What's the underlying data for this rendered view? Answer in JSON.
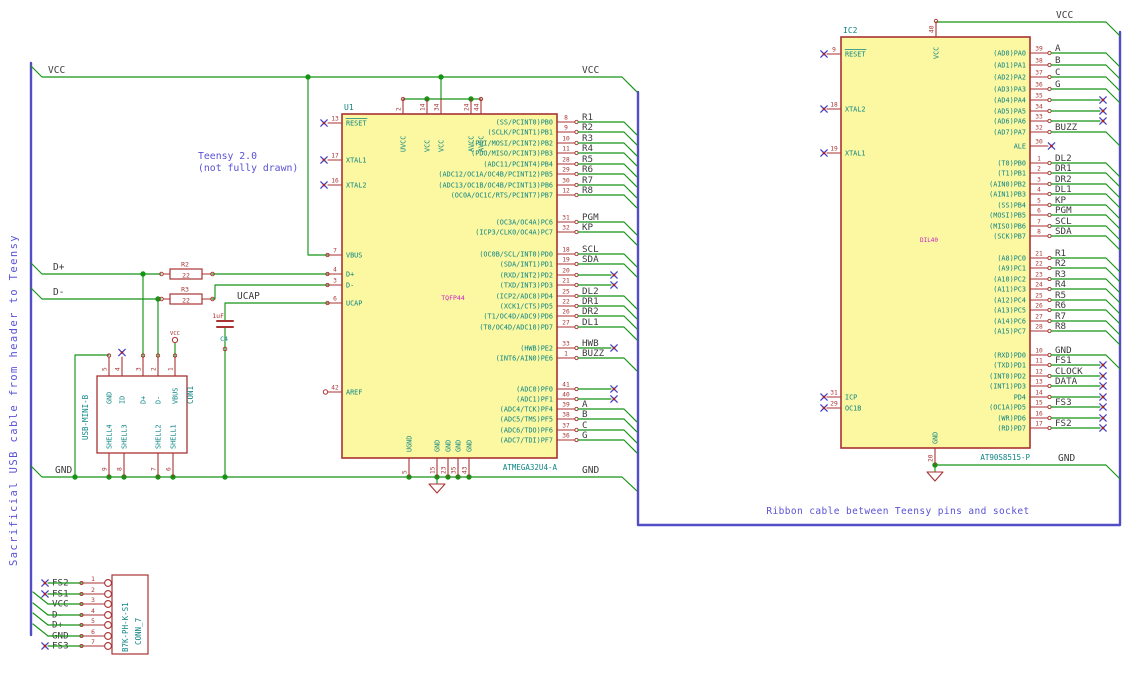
{
  "colors": {
    "wire": "#169416",
    "bus": "#544dc8",
    "outline": "#a93232",
    "fill": "#fbf8a1",
    "pin_name": "#0d8484",
    "pin_num": "#a93232",
    "label": "#3a3a3a",
    "note": "#5a52d5",
    "footprint": "#c820c8",
    "nc": "#4840c0"
  },
  "notes": {
    "cable": "Sacrificial USB cable from header to Teensy",
    "teensy1": "Teensy 2.0",
    "teensy2": "(not fully drawn)",
    "ribbon": "Ribbon cable between Teensy pins and socket"
  },
  "net_labels": {
    "vcc": "VCC",
    "gnd": "GND",
    "dplus": "D+",
    "dminus": "D-",
    "ucap": "UCAP"
  },
  "u1": {
    "ref": "U1",
    "value": "ATMEGA32U4-A",
    "footprint": "TQFP44",
    "top_pins": [
      {
        "num": "2",
        "name": "UVCC"
      },
      {
        "num": "14",
        "name": "VCC"
      },
      {
        "num": "34",
        "name": "VCC"
      },
      {
        "num": "24",
        "name": "AVCC"
      },
      {
        "num": "44",
        "name": "AVCC"
      }
    ],
    "bottom_pins": [
      {
        "num": "5",
        "name": "UGND"
      },
      {
        "num": "15",
        "name": "GND"
      },
      {
        "num": "23",
        "name": "GND"
      },
      {
        "num": "35",
        "name": "GND"
      },
      {
        "num": "43",
        "name": "GND"
      }
    ],
    "left_pins": [
      {
        "num": "13",
        "name": "RESET",
        "overline": true,
        "term": "nc"
      },
      {
        "num": "17",
        "name": "XTAL1",
        "term": "nc"
      },
      {
        "num": "16",
        "name": "XTAL2",
        "term": "nc"
      },
      {
        "num": "7",
        "name": "VBUS",
        "term": "wire"
      },
      {
        "num": "4",
        "name": "D+",
        "term": "wire"
      },
      {
        "num": "3",
        "name": "D-",
        "term": "wire"
      },
      {
        "num": "6",
        "name": "UCAP",
        "term": "wire"
      },
      {
        "num": "42",
        "name": "AREF",
        "term": "open"
      }
    ],
    "right_pins": [
      {
        "num": "8",
        "name": "(SS/PCINT0)PB0",
        "label": "R1",
        "term": "bus"
      },
      {
        "num": "9",
        "name": "(SCLK/PCINT1)PB1",
        "label": "R2",
        "term": "bus"
      },
      {
        "num": "10",
        "name": "(PDI/MOSI/PCINT2)PB2",
        "label": "R3",
        "term": "bus"
      },
      {
        "num": "11",
        "name": "(PDO/MISO/PCINT3)PB3",
        "label": "R4",
        "term": "bus"
      },
      {
        "num": "28",
        "name": "(ADC11/PCINT4)PB4",
        "label": "R5",
        "term": "bus"
      },
      {
        "num": "29",
        "name": "(ADC12/OC1A/OC4B/PCINT12)PB5",
        "label": "R6",
        "term": "bus"
      },
      {
        "num": "30",
        "name": "(ADC13/OC1B/OC4B/PCINT13)PB6",
        "label": "R7",
        "term": "bus"
      },
      {
        "num": "12",
        "name": "(OC0A/OC1C/RTS/PCINT7)PB7",
        "label": "R8",
        "term": "bus"
      },
      {
        "num": "31",
        "name": "(OC3A/OC4A)PC6",
        "label": "PGM",
        "term": "bus"
      },
      {
        "num": "32",
        "name": "(ICP3/CLK0/OC4A)PC7",
        "label": "KP",
        "term": "bus"
      },
      {
        "num": "18",
        "name": "(OC0B/SCL/INT0)PD0",
        "label": "SCL",
        "term": "bus"
      },
      {
        "num": "19",
        "name": "(SDA/INT1)PD1",
        "label": "SDA",
        "term": "bus"
      },
      {
        "num": "20",
        "name": "(RXD/INT2)PD2",
        "label": "",
        "term": "nc"
      },
      {
        "num": "21",
        "name": "(TXD/INT3)PD3",
        "label": "",
        "term": "nc"
      },
      {
        "num": "25",
        "name": "(ICP2/ADC8)PD4",
        "label": "DL2",
        "term": "bus"
      },
      {
        "num": "22",
        "name": "(XCK1/CTS)PD5",
        "label": "DR1",
        "term": "bus"
      },
      {
        "num": "26",
        "name": "(T1/OC4D/ADC9)PD6",
        "label": "DR2",
        "term": "bus"
      },
      {
        "num": "27",
        "name": "(T0/OC4D/ADC10)PD7",
        "label": "DL1",
        "term": "bus"
      },
      {
        "num": "33",
        "name": "(HWB)PE2",
        "label": "HWB",
        "term": "nc"
      },
      {
        "num": "1",
        "name": "(INT6/AIN0)PE6",
        "label": "BUZZ",
        "term": "bus"
      },
      {
        "num": "41",
        "name": "(ADC0)PF0",
        "label": "",
        "term": "nc"
      },
      {
        "num": "40",
        "name": "(ADC1)PF1",
        "label": "",
        "term": "nc"
      },
      {
        "num": "39",
        "name": "(ADC4/TCK)PF4",
        "label": "A",
        "term": "bus"
      },
      {
        "num": "38",
        "name": "(ADC5/TMS)PF5",
        "label": "B",
        "term": "bus"
      },
      {
        "num": "37",
        "name": "(ADC6/TDO)PF6",
        "label": "C",
        "term": "bus"
      },
      {
        "num": "36",
        "name": "(ADC7/TDI)PF7",
        "label": "G",
        "term": "bus"
      }
    ]
  },
  "ic2": {
    "ref": "IC2",
    "value": "AT90S8515-P",
    "footprint": "DIL40",
    "top_pin": {
      "num": "40",
      "name": "VCC"
    },
    "bottom_pin": {
      "num": "20",
      "name": "GND"
    },
    "left_pins": [
      {
        "num": "9",
        "name": "RESET",
        "overline": true
      },
      {
        "num": "18",
        "name": "XTAL2"
      },
      {
        "num": "19",
        "name": "XTAL1"
      },
      {
        "num": "31",
        "name": "ICP"
      },
      {
        "num": "29",
        "name": "OC1B"
      }
    ],
    "right_pins": [
      {
        "num": "39",
        "name": "(AD0)PA0",
        "label": "A",
        "term": "bus"
      },
      {
        "num": "38",
        "name": "(AD1)PA1",
        "label": "B",
        "term": "bus"
      },
      {
        "num": "37",
        "name": "(AD2)PA2",
        "label": "C",
        "term": "bus"
      },
      {
        "num": "36",
        "name": "(AD3)PA3",
        "label": "G",
        "term": "bus"
      },
      {
        "num": "35",
        "name": "(AD4)PA4",
        "label": "",
        "term": "nc"
      },
      {
        "num": "34",
        "name": "(AD5)PA5",
        "label": "",
        "term": "nc"
      },
      {
        "num": "33",
        "name": "(AD6)PA6",
        "label": "",
        "term": "nc"
      },
      {
        "num": "32",
        "name": "(AD7)PA7",
        "label": "BUZZ",
        "term": "bus"
      },
      {
        "num": "30",
        "name": "ALE",
        "label": "",
        "term": "ncshort"
      },
      {
        "num": "1",
        "name": "(T0)PB0",
        "label": "DL2",
        "term": "bus"
      },
      {
        "num": "2",
        "name": "(T1)PB1",
        "label": "DR1",
        "term": "bus"
      },
      {
        "num": "3",
        "name": "(AIN0)PB2",
        "label": "DR2",
        "term": "bus"
      },
      {
        "num": "4",
        "name": "(AIN1)PB3",
        "label": "DL1",
        "term": "bus"
      },
      {
        "num": "5",
        "name": "(SS)PB4",
        "label": "KP",
        "term": "bus"
      },
      {
        "num": "6",
        "name": "(MOSI)PB5",
        "label": "PGM",
        "term": "bus"
      },
      {
        "num": "7",
        "name": "(MISO)PB6",
        "label": "SCL",
        "term": "bus"
      },
      {
        "num": "8",
        "name": "(SCK)PB7",
        "label": "SDA",
        "term": "bus"
      },
      {
        "num": "21",
        "name": "(A8)PC0",
        "label": "R1",
        "term": "bus"
      },
      {
        "num": "22",
        "name": "(A9)PC1",
        "label": "R2",
        "term": "bus"
      },
      {
        "num": "23",
        "name": "(A10)PC2",
        "label": "R3",
        "term": "bus"
      },
      {
        "num": "24",
        "name": "(A11)PC3",
        "label": "R4",
        "term": "bus"
      },
      {
        "num": "25",
        "name": "(A12)PC4",
        "label": "R5",
        "term": "bus"
      },
      {
        "num": "26",
        "name": "(A13)PC5",
        "label": "R6",
        "term": "bus"
      },
      {
        "num": "27",
        "name": "(A14)PC6",
        "label": "R7",
        "term": "bus"
      },
      {
        "num": "28",
        "name": "(A15)PC7",
        "label": "R8",
        "term": "bus"
      },
      {
        "num": "10",
        "name": "(RXD)PD0",
        "label": "GND",
        "term": "bus"
      },
      {
        "num": "11",
        "name": "(TXD)PD1",
        "label": "FS1",
        "term": "nc"
      },
      {
        "num": "12",
        "name": "(INT0)PD2",
        "label": "CLOCK",
        "term": "nc"
      },
      {
        "num": "13",
        "name": "(INT1)PD3",
        "label": "DATA",
        "term": "nc"
      },
      {
        "num": "14",
        "name": "PD4",
        "label": "",
        "term": "nc"
      },
      {
        "num": "15",
        "name": "(OC1A)PD5",
        "label": "FS3",
        "term": "nc"
      },
      {
        "num": "16",
        "name": "(WR)PD6",
        "label": "",
        "term": "nc"
      },
      {
        "num": "17",
        "name": "(RD)PD7",
        "label": "FS2",
        "term": "nc"
      }
    ]
  },
  "con1": {
    "ref": "CON1",
    "value": "USB-MINI-B",
    "top_pins": [
      {
        "num": "5",
        "name": "GND"
      },
      {
        "num": "4",
        "name": "ID"
      },
      {
        "num": "3",
        "name": "D+"
      },
      {
        "num": "2",
        "name": "D-"
      },
      {
        "num": "1",
        "name": "VBUS"
      }
    ],
    "bottom_pins": [
      {
        "num": "9",
        "name": "SHELL4"
      },
      {
        "num": "8",
        "name": "SHELL3"
      },
      {
        "num": "7",
        "name": "SHELL2"
      },
      {
        "num": "6",
        "name": "SHELL1"
      }
    ],
    "vbus_power_label": "VCC"
  },
  "conn7": {
    "ref": "CONN_7",
    "value": "B7K-PH-K-S1",
    "pins": [
      {
        "num": "1",
        "label": "FS2",
        "term": "nc"
      },
      {
        "num": "2",
        "label": "FS1",
        "term": "nc"
      },
      {
        "num": "3",
        "label": "VCC",
        "term": "bus"
      },
      {
        "num": "4",
        "label": "D-",
        "term": "bus"
      },
      {
        "num": "5",
        "label": "D+",
        "term": "bus"
      },
      {
        "num": "6",
        "label": "GND",
        "term": "bus"
      },
      {
        "num": "7",
        "label": "FS3",
        "term": "nc"
      }
    ]
  },
  "r2": {
    "ref": "R2",
    "value": "22"
  },
  "r3": {
    "ref": "R3",
    "value": "22"
  },
  "c4": {
    "ref": "C4",
    "value": "1uF"
  }
}
